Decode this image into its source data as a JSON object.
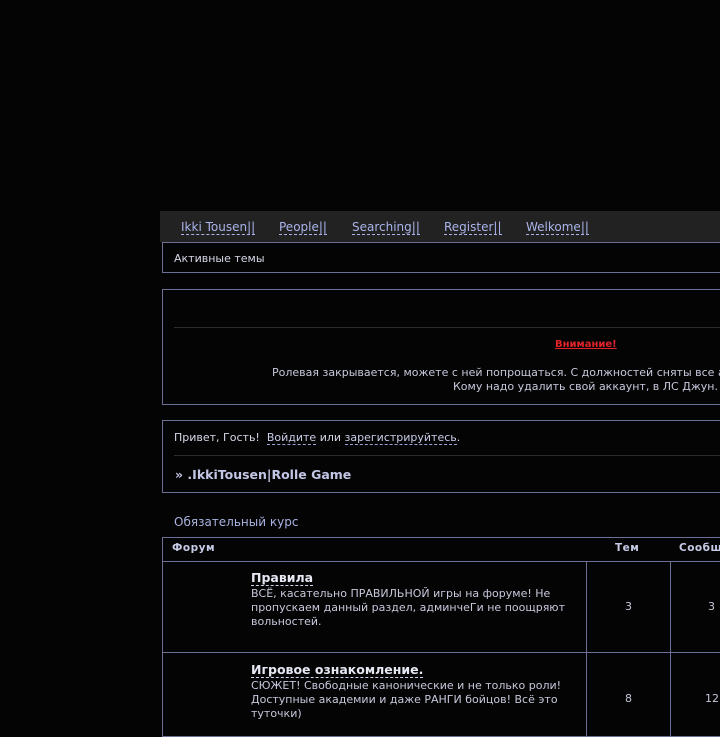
{
  "nav": {
    "items": [
      "Ikki Tousen||",
      "People||",
      "Searching||",
      "Register||",
      "Welkome||"
    ]
  },
  "active_topics": {
    "label": "Активные темы"
  },
  "announcement": {
    "warning": "Внимание!",
    "line1": "Ролевая закрывается, можете с ней попрощаться. С должностей сняты все а",
    "line2": "Кому надо удалить свой аккаунт, в ЛС Джун."
  },
  "welcome": {
    "greeting": "Привет, Гость!",
    "login_link": "Войдите",
    "or_text": "или",
    "register_link": "зарегистрируйтесь",
    "period": ".",
    "breadcrumb": "» .IkkiTousen|Rolle Game"
  },
  "category": {
    "title": "Обязательный курс"
  },
  "table": {
    "headers": {
      "forum": "Форум",
      "topics": "Тем",
      "posts": "Сообщ"
    },
    "rows": [
      {
        "name": "Правила",
        "description": "ВСЁ, касательно ПРАВИЛЬНОЙ игры на форуме! Не пропускаем данный раздел, админчеГи не поощряют вольностей.",
        "topics": "3",
        "posts": "3"
      },
      {
        "name": "Игровое ознакомление.",
        "description": "СЮЖЕТ! Свободные канонические и не только роли! Доступные академии и даже РАНГИ бойцов! Всё это туточки)",
        "topics": "8",
        "posts": "12"
      }
    ]
  }
}
